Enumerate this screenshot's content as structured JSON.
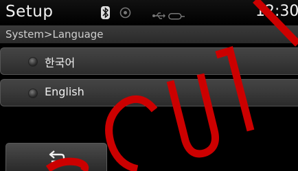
{
  "header": {
    "title": "Setup",
    "clock": "12:30",
    "icons": [
      "bluetooth-icon",
      "disc-icon",
      "usb-icon",
      "aux-icon"
    ]
  },
  "breadcrumb": "System>Language",
  "languages": [
    {
      "label": "한국어"
    },
    {
      "label": "English"
    }
  ],
  "footer": {
    "back_icon": "return-arrow-icon"
  },
  "watermark": {
    "text": "SCUT",
    "color": "#cc0000"
  }
}
